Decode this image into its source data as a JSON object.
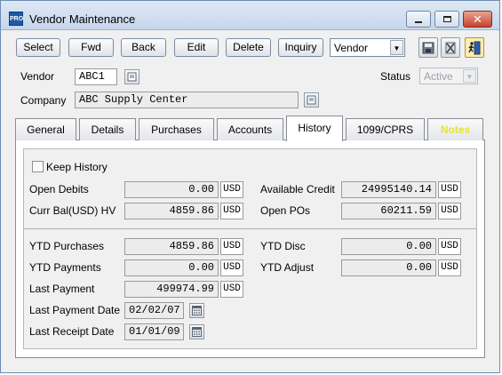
{
  "window": {
    "app_icon_text": "PRO",
    "title": "Vendor Maintenance"
  },
  "toolbar": {
    "buttons": [
      "Select",
      "Fwd",
      "Back",
      "Edit",
      "Delete",
      "Inquiry"
    ],
    "mode_select": "Vendor",
    "icons": [
      "save-icon",
      "delete-record-icon",
      "exit-icon"
    ]
  },
  "header": {
    "vendor_label": "Vendor",
    "vendor_value": "ABC1",
    "company_label": "Company",
    "company_value": "ABC Supply Center",
    "status_label": "Status",
    "status_value": "Active"
  },
  "tabs": {
    "items": [
      "General",
      "Details",
      "Purchases",
      "Accounts",
      "History",
      "1099/CPRS",
      "Notes"
    ],
    "selected": "History"
  },
  "history": {
    "keep_history_label": "Keep History",
    "keep_history_checked": false,
    "currency": "USD",
    "open_debits_label": "Open Debits",
    "open_debits": "0.00",
    "available_credit_label": "Available Credit",
    "available_credit": "24995140.14",
    "curr_bal_label": "Curr Bal(USD) HV",
    "curr_bal": "4859.86",
    "open_pos_label": "Open POs",
    "open_pos": "60211.59",
    "ytd_purchases_label": "YTD Purchases",
    "ytd_purchases": "4859.86",
    "ytd_disc_label": "YTD Disc",
    "ytd_disc": "0.00",
    "ytd_payments_label": "YTD Payments",
    "ytd_payments": "0.00",
    "ytd_adjust_label": "YTD Adjust",
    "ytd_adjust": "0.00",
    "last_payment_label": "Last Payment",
    "last_payment": "499974.99",
    "last_payment_date_label": "Last Payment Date",
    "last_payment_date": "02/02/07",
    "last_receipt_date_label": "Last Receipt Date",
    "last_receipt_date": "01/01/09"
  },
  "colors": {
    "notes_tab_text": "#e3e33a",
    "window_border": "#6b8bb3"
  }
}
